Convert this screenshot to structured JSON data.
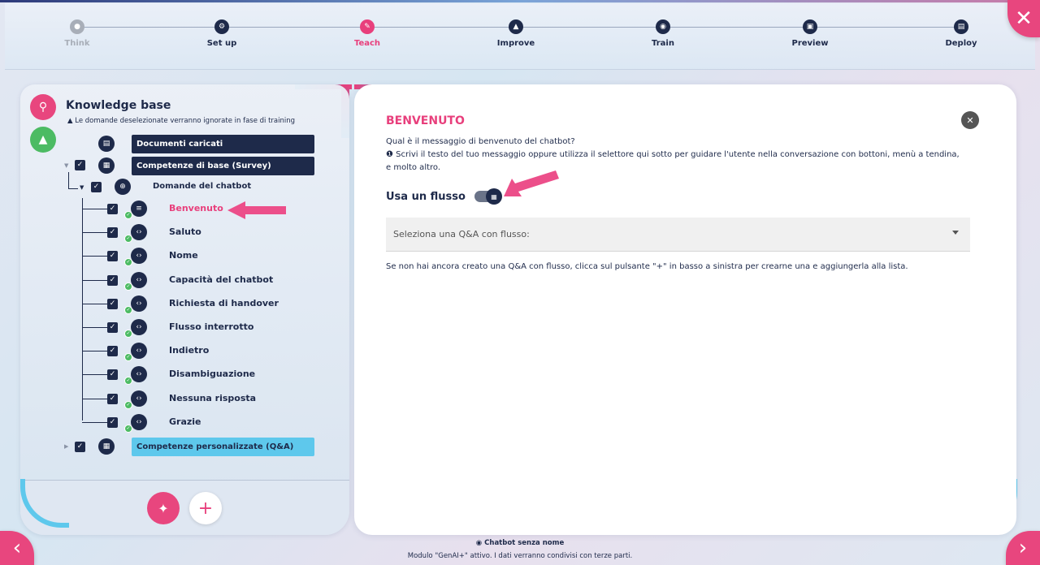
{
  "steps": [
    {
      "label": "Think",
      "icon": "bulb-icon",
      "state": "disabled"
    },
    {
      "label": "Set up",
      "icon": "gear-icon",
      "state": "done"
    },
    {
      "label": "Teach",
      "icon": "pencil-icon",
      "state": "active"
    },
    {
      "label": "Improve",
      "icon": "improve-icon",
      "state": "todo"
    },
    {
      "label": "Train",
      "icon": "train-icon",
      "state": "todo"
    },
    {
      "label": "Preview",
      "icon": "preview-icon",
      "state": "todo"
    },
    {
      "label": "Deploy",
      "icon": "deploy-icon",
      "state": "todo"
    }
  ],
  "knowledge_base": {
    "title": "Knowledge base",
    "note": "Le domande deselezionate verranno ignorate in fase di training",
    "docs_label": "Documenti caricati",
    "base_skills_label": "Competenze di base (Survey)",
    "chatbot_questions_label": "Domande del chatbot",
    "items": [
      {
        "label": "Benvenuto",
        "selected": true
      },
      {
        "label": "Saluto",
        "selected": false
      },
      {
        "label": "Nome",
        "selected": false
      },
      {
        "label": "Capacità del chatbot",
        "selected": false
      },
      {
        "label": "Richiesta di handover",
        "selected": false
      },
      {
        "label": "Flusso interrotto",
        "selected": false
      },
      {
        "label": "Indietro",
        "selected": false
      },
      {
        "label": "Disambiguazione",
        "selected": false
      },
      {
        "label": "Nessuna risposta",
        "selected": false
      },
      {
        "label": "Grazie",
        "selected": false
      }
    ],
    "custom_skills_label": "Competenze personalizzate (Q&A)"
  },
  "detail": {
    "title": "BENVENUTO",
    "question": "Qual è il messaggio di benvenuto del chatbot?",
    "hint_line1": "Scrivi il testo del tuo messaggio oppure utilizza il selettore qui sotto per guidare l'utente nella conversazione con bottoni, menù a tendina,",
    "hint_line2": "e molto altro.",
    "flow_label": "Usa un flusso",
    "flow_enabled": true,
    "select_placeholder": "Seleziona una Q&A con flusso:",
    "info": "Se non hai ancora creato una Q&A con flusso, clicca sul pulsante \"+\" in basso a sinistra per crearne una e aggiungerla alla lista."
  },
  "footer": {
    "chatbot_name": "Chatbot senza nome",
    "notice": "Modulo \"GenAI+\" attivo. I dati verranno condivisi con terze parti."
  },
  "colors": {
    "accent": "#e83f7c",
    "navy": "#1e2a4a",
    "success": "#4cbb63",
    "light_blue": "#5ec8ec"
  }
}
